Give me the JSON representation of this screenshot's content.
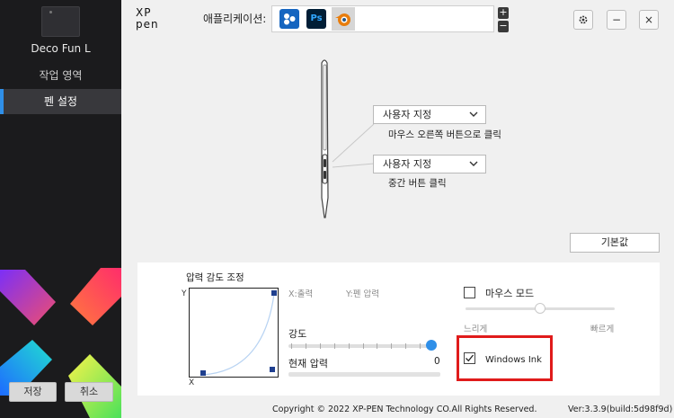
{
  "sidebar": {
    "device_name": "Deco Fun L",
    "items": [
      {
        "label": "작업 영역",
        "active": false
      },
      {
        "label": "펜 설정",
        "active": true
      }
    ],
    "save_label": "저장",
    "cancel_label": "취소"
  },
  "header": {
    "logo_line1": "XP",
    "logo_line2": "pen",
    "applications_label": "애플리케이션:",
    "apps": [
      {
        "name": "all-apps",
        "icon": "app-grid-icon",
        "color": "#1565c0"
      },
      {
        "name": "Photoshop",
        "icon": "photoshop-icon",
        "text": "Ps",
        "color": "#001e36"
      },
      {
        "name": "Blender",
        "icon": "blender-icon",
        "color": "#e87d0d"
      }
    ],
    "add_symbol": "+",
    "remove_symbol": "−",
    "settings_icon": "gear-icon",
    "minimize_symbol": "−",
    "close_symbol": "×"
  },
  "pen": {
    "upper_button": {
      "selected": "사용자 지정",
      "action": "마우스 오른쪽 버튼으로 클릭"
    },
    "lower_button": {
      "selected": "사용자 지정",
      "action": "중간 버튼 클릭"
    },
    "default_label": "기본값"
  },
  "pressure": {
    "title": "압력 감도 조정",
    "axis_y": "Y",
    "axis_x": "X",
    "x_output_label": "X:출력",
    "y_pressure_label": "Y:펜 압력",
    "strength_label": "강도",
    "strength_ticks": 11,
    "strength_value": 1.0,
    "current_pressure_label": "현재 압력",
    "current_pressure_value": "0"
  },
  "mouse_mode": {
    "label": "마우스 모드",
    "checked": false,
    "slow_label": "느리게",
    "fast_label": "빠르게",
    "speed_value": 0.5
  },
  "windows_ink": {
    "label": "Windows Ink",
    "checked": true
  },
  "footer": {
    "copyright": "Copyright © 2022  XP-PEN Technology CO.All Rights Reserved.",
    "version": "Ver:3.3.9(build:5d98f9d)"
  },
  "colors": {
    "accent": "#2f8fe8",
    "highlight": "#e01b1b",
    "sidebar_bg": "#1b1b1d"
  }
}
